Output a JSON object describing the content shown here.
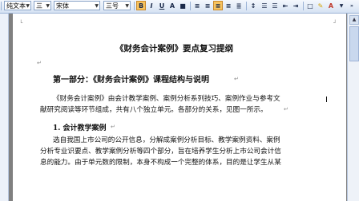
{
  "toolbar": {
    "style_value": "纯文本",
    "font_size_cn": "三",
    "font_name": "宋体",
    "size_value": "三号",
    "bold_label": "B",
    "italic_label": "I",
    "underline_label": "U",
    "char_scale_label": "A",
    "font_color_label": "A"
  },
  "document": {
    "title": "《财务会计案例》要点复习提纲",
    "part_heading": "第一部分：《财务会计案例》课程结构与说明",
    "para1_line1": "《财务会计案例》由会计教学案例、案例分析系列技巧、案例作业与参考文",
    "para1_line2": "献研究阅读等环节组成，共有八个独立单元。各部分的关系，见图一所示。",
    "section_heading": "1.  会计教学案例",
    "para2_line1": "选自我国上市公司的公开信息，分解成案例分析目标、教学案例资料、案例",
    "para2_line2": "分析专业识要点、教学案例分析等四个部分，旨在培养学生分析上市公司会计信",
    "para2_line3": "息的能力。由于单元数的限制，本身不构成一个完整的体系，目的是让学生从某"
  },
  "colors": {
    "toolbar_bg": "#d5e2f3",
    "page_bg": "#ffffff",
    "workspace_bg": "#808080",
    "active_button": "#f7c35e"
  }
}
